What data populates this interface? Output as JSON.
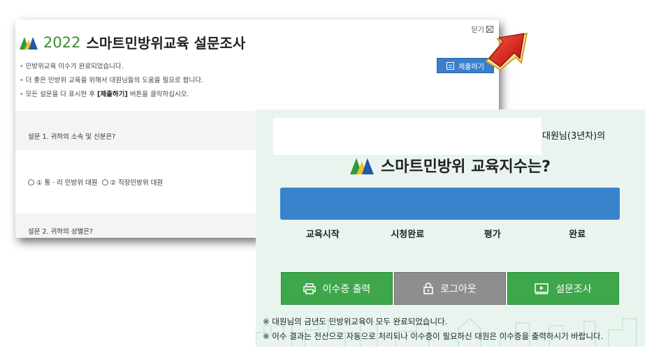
{
  "survey": {
    "close_label": "닫기",
    "title_year": "2022",
    "title_text": "스마트민방위교육 설문조사",
    "notes": [
      "민방위교육 이수가 완료되었습니다.",
      "더 좋은 민방위 교육을 위해서 대원님들의 도움을 필요로 합니다.",
      "모든 설문을 다 표시한 후",
      "[제출하기]",
      "버튼을 클릭하십시오."
    ],
    "submit_label": "제출하기",
    "q1": "설문 1. 귀하의 소속 및 신분은?",
    "q1_options": [
      "① 통ㆍ리 민방위 대원",
      "② 직장민방위 대원"
    ],
    "q2": "설문 2. 귀하의 성별은?"
  },
  "panel": {
    "member": "대원님(3년차)의",
    "title": "스마트민방위 교육지수는?",
    "progress": 1.0,
    "steps": [
      "교육시작",
      "시청완료",
      "평가",
      "완료"
    ],
    "buttons": {
      "certificate": "이수증 출력",
      "logout": "로그아웃",
      "survey": "설문조사"
    },
    "footnotes": [
      "※ 대원님의 금년도 민방위교육이 모두 완료되었습니다.",
      "※ 이수 결과는 전산으로 자동으로 처리되나 이수증이 필요하신 대원은 이수증을 출력하시기 바랍니다."
    ]
  },
  "colors": {
    "accent_green": "#3ea74b",
    "accent_blue": "#3b82cc",
    "arrow_red": "#d0141c"
  }
}
